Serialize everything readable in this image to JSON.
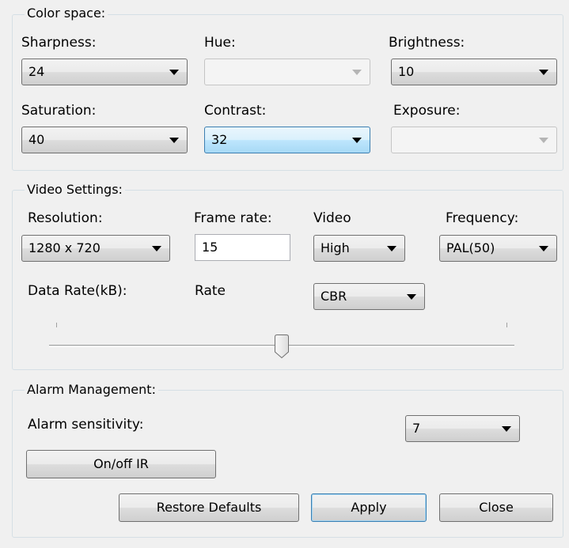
{
  "color_space": {
    "title": "Color space:",
    "sharpness": {
      "label": "Sharpness:",
      "value": "24"
    },
    "hue": {
      "label": "Hue:",
      "value": ""
    },
    "brightness": {
      "label": "Brightness:",
      "value": "10"
    },
    "saturation": {
      "label": "Saturation:",
      "value": "40"
    },
    "contrast": {
      "label": "Contrast:",
      "value": "32"
    },
    "exposure": {
      "label": "Exposure:",
      "value": ""
    }
  },
  "video_settings": {
    "title": "Video Settings:",
    "resolution": {
      "label": "Resolution:",
      "value": "1280 x 720"
    },
    "frame_rate": {
      "label": "Frame rate:",
      "value": "15"
    },
    "video": {
      "label": "Video",
      "value": "High"
    },
    "frequency": {
      "label": "Frequency:",
      "value": "PAL(50)"
    },
    "data_rate": {
      "label": "Data Rate(kB):"
    },
    "rate": {
      "label": "Rate",
      "value": "CBR"
    },
    "slider_position": 0.5
  },
  "alarm": {
    "title": "Alarm Management:",
    "sensitivity": {
      "label": "Alarm sensitivity:",
      "value": "7"
    },
    "ir_button": "On/off IR"
  },
  "buttons": {
    "restore": "Restore Defaults",
    "apply": "Apply",
    "close": "Close"
  }
}
